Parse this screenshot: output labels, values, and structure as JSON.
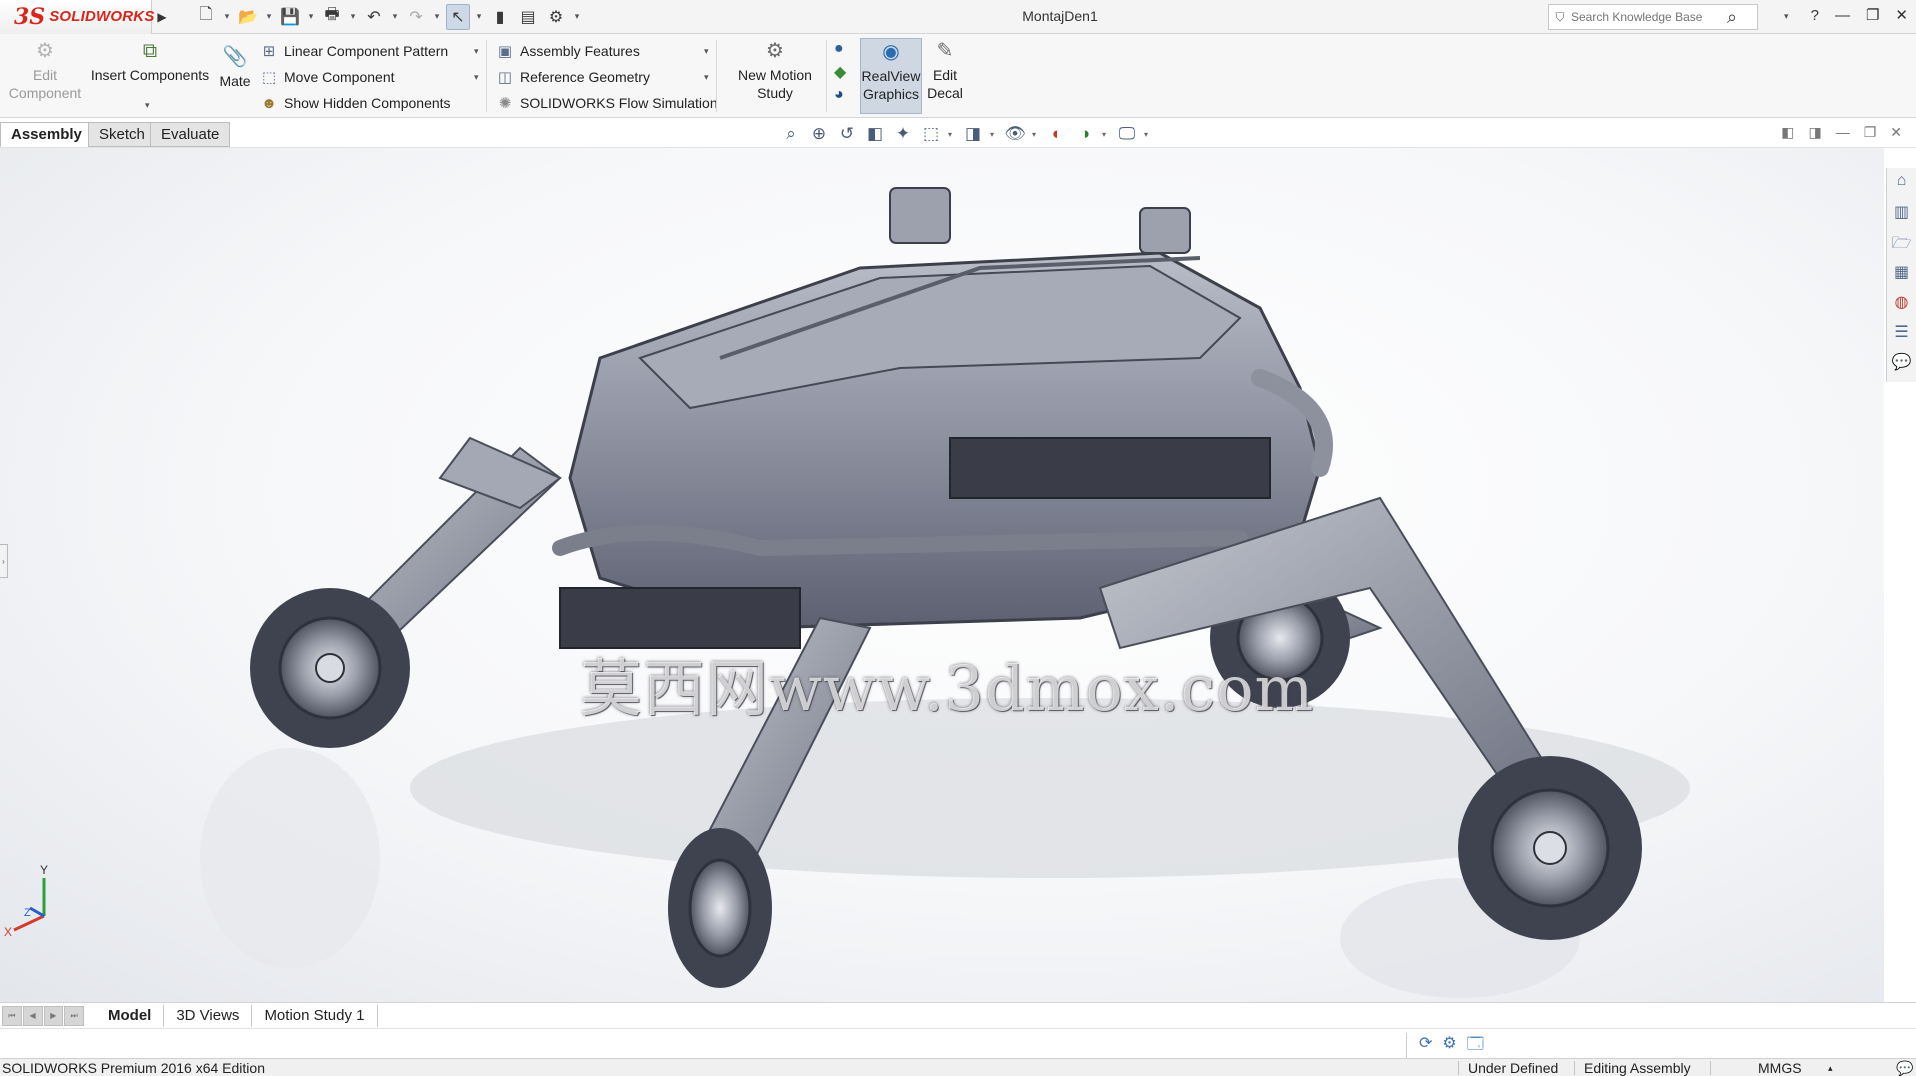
{
  "app": {
    "logo_ds": "3S",
    "logo_text": "SOLIDWORKS",
    "document_title": "MontajDen1"
  },
  "search": {
    "placeholder": "Search Knowledge Base"
  },
  "window_controls": {
    "help": "?",
    "minimize": "—",
    "restore": "❐",
    "close": "✕"
  },
  "ribbon": {
    "edit_component": "Edit Component",
    "insert_components": "Insert Components",
    "mate": "Mate",
    "linear_component_pattern": "Linear Component Pattern",
    "move_component": "Move Component",
    "show_hidden_components": "Show Hidden Components",
    "assembly_features": "Assembly Features",
    "reference_geometry": "Reference Geometry",
    "flow_simulation": "SOLIDWORKS Flow Simulation",
    "new_motion_study_line1": "New Motion",
    "new_motion_study_line2": "Study",
    "realview_line1": "RealView",
    "realview_line2": "Graphics",
    "edit_decal_line1": "Edit",
    "edit_decal_line2": "Decal"
  },
  "command_tabs": [
    "Assembly",
    "Sketch",
    "Evaluate"
  ],
  "watermark": "莫西网www.3dmox.com",
  "triad": {
    "x": "X",
    "y": "Y",
    "z": "Z"
  },
  "bottom_tabs": [
    "Model",
    "3D Views",
    "Motion Study 1"
  ],
  "status": {
    "edition": "SOLIDWORKS Premium 2016 x64 Edition",
    "definition": "Under Defined",
    "mode": "Editing Assembly",
    "units": "MMGS"
  },
  "colors": {
    "brand_red": "#d9261c",
    "accent_blue": "#3e74b6",
    "model_gray": "#8d93a2"
  }
}
